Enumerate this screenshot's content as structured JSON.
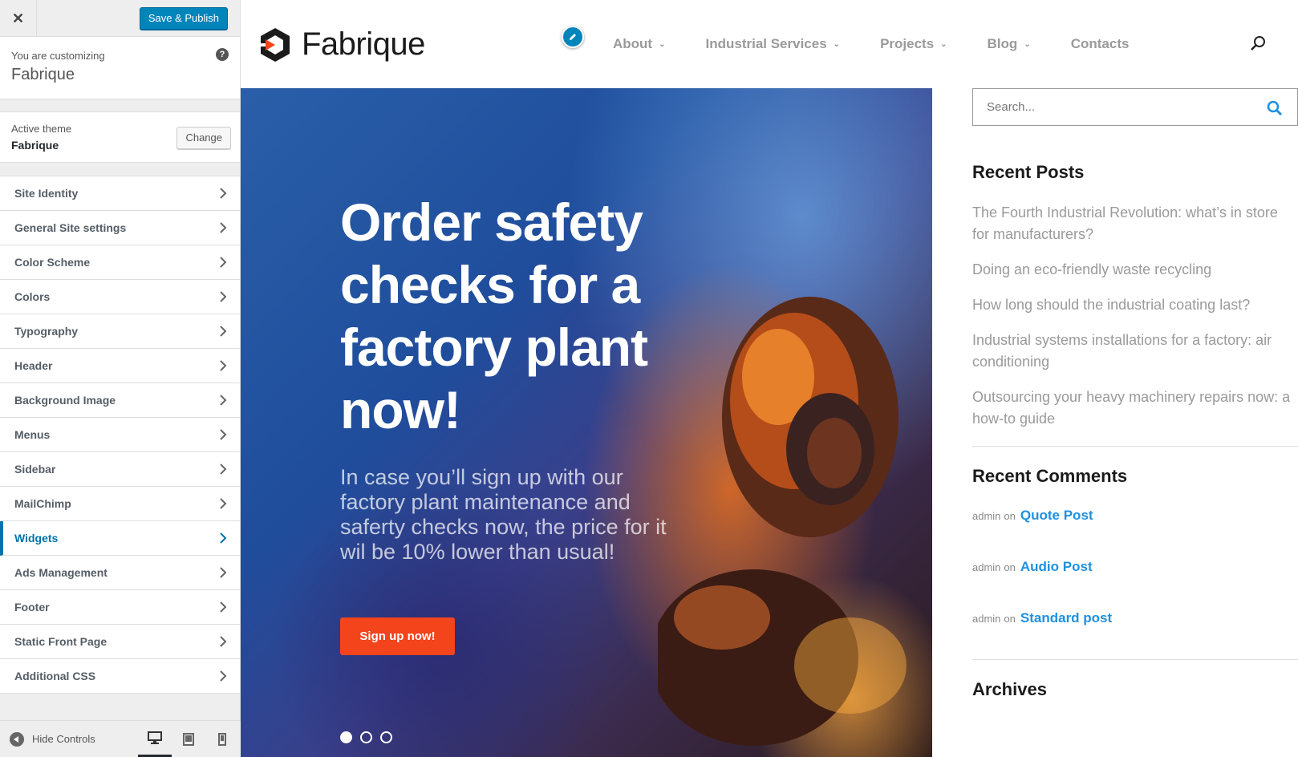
{
  "customizer": {
    "close_label": "✕",
    "save_label": "Save & Publish",
    "customizing_label": "You are customizing",
    "site_name": "Fabrique",
    "help_label": "?",
    "active_theme_label": "Active theme",
    "active_theme_name": "Fabrique",
    "change_label": "Change",
    "sections": [
      {
        "label": "Site Identity"
      },
      {
        "label": "General Site settings"
      },
      {
        "label": "Color Scheme"
      },
      {
        "label": "Colors"
      },
      {
        "label": "Typography"
      },
      {
        "label": "Header"
      },
      {
        "label": "Background Image"
      },
      {
        "label": "Menus"
      },
      {
        "label": "Sidebar"
      },
      {
        "label": "MailChimp"
      },
      {
        "label": "Widgets"
      },
      {
        "label": "Ads Management"
      },
      {
        "label": "Footer"
      },
      {
        "label": "Static Front Page"
      },
      {
        "label": "Additional CSS"
      }
    ],
    "active_section": "Widgets",
    "hide_controls_label": "Hide Controls",
    "devices": [
      "desktop-icon",
      "tablet-icon",
      "mobile-icon"
    ],
    "accent_color": "#0073aa",
    "primary_button_color": "#0085ba"
  },
  "site": {
    "logo_text": "Fabrique",
    "nav": [
      {
        "label": "About",
        "has_dropdown": true
      },
      {
        "label": "Industrial Services",
        "has_dropdown": true
      },
      {
        "label": "Projects",
        "has_dropdown": true
      },
      {
        "label": "Blog",
        "has_dropdown": true
      },
      {
        "label": "Contacts",
        "has_dropdown": false
      }
    ],
    "hero": {
      "title": "Order safety checks for a factory plant now!",
      "subtitle": "In case you’ll sign up with our factory plant maintenance and saferty checks now, the price for it wil be 10% lower than usual!",
      "cta_label": "Sign up now!",
      "slides_count": 3,
      "active_slide": 1,
      "cta_color": "#f3441c"
    },
    "sidebar": {
      "search_placeholder": "Search...",
      "recent_posts_title": "Recent Posts",
      "recent_posts": [
        "The Fourth Industrial Revolution: what’s in store for manufacturers?",
        "Doing an eco-friendly waste recycling",
        "How long should the industrial coating last?",
        "Industrial systems installations for a factory: air conditioning",
        "Outsourcing your heavy machinery repairs now: a how-to guide"
      ],
      "recent_comments_title": "Recent Comments",
      "recent_comments": [
        {
          "author": "admin",
          "on": "on",
          "post": "Quote Post"
        },
        {
          "author": "admin",
          "on": "on",
          "post": "Audio Post"
        },
        {
          "author": "admin",
          "on": "on",
          "post": "Standard post"
        }
      ],
      "archives_title": "Archives",
      "link_color": "#1e90e0"
    }
  }
}
